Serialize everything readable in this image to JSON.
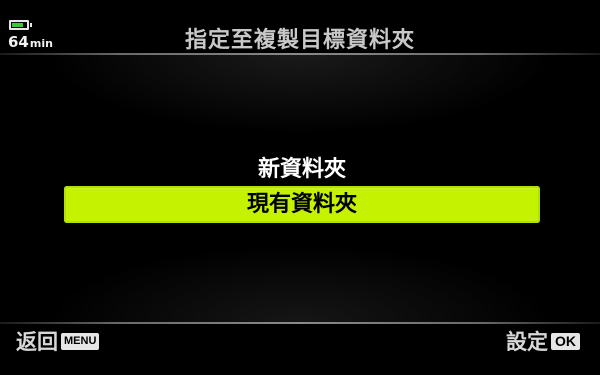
{
  "status": {
    "battery_level": 0.8,
    "battery_color": "#33cc33",
    "time_remaining_value": "64",
    "time_remaining_unit": "min"
  },
  "header": {
    "title": "指定至複製目標資料夾"
  },
  "menu": {
    "items": [
      {
        "label": "新資料夾",
        "selected": false
      },
      {
        "label": "現有資料夾",
        "selected": true
      }
    ],
    "highlight_color": "#c4f200"
  },
  "footer": {
    "back_label": "返回",
    "back_key": "MENU",
    "set_label": "設定",
    "set_key": "OK"
  }
}
